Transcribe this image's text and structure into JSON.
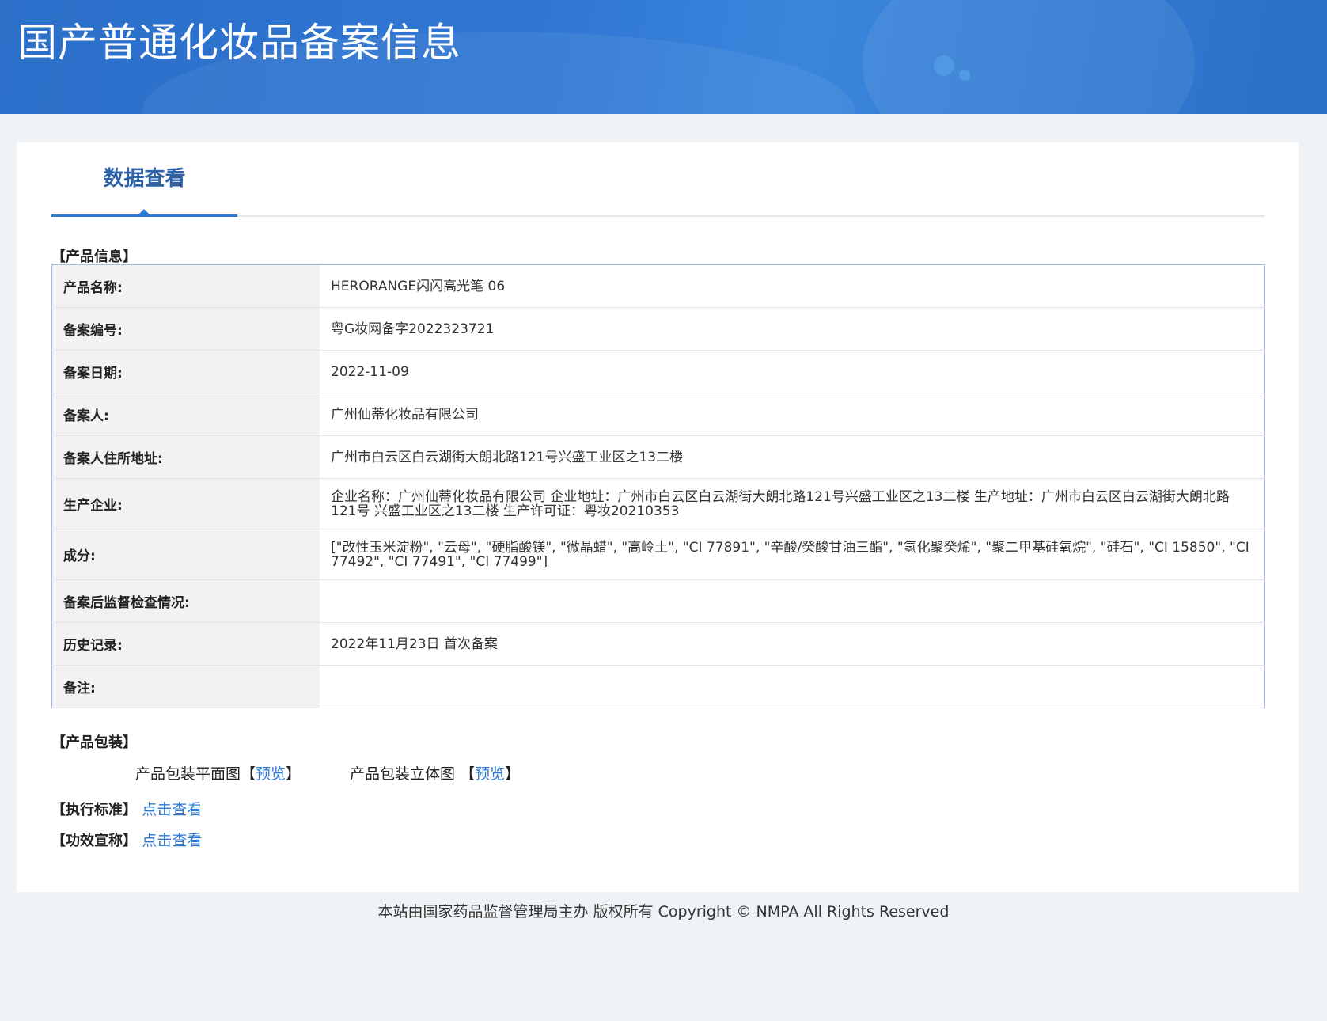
{
  "header": {
    "title": "国产普通化妆品备案信息"
  },
  "tab": {
    "label": "数据查看"
  },
  "sections": {
    "product_info": "【产品信息】",
    "packaging": "【产品包装】",
    "standard": "【执行标准】",
    "efficacy": "【功效宣称】"
  },
  "info_rows": [
    {
      "label": "产品名称:",
      "value": "HERORANGE闪闪高光笔 06"
    },
    {
      "label": "备案编号:",
      "value": "粤G妆网备字2022323721"
    },
    {
      "label": "备案日期:",
      "value": "2022-11-09"
    },
    {
      "label": "备案人:",
      "value": "广州仙蒂化妆品有限公司"
    },
    {
      "label": "备案人住所地址:",
      "value": "广州市白云区白云湖街大朗北路121号兴盛工业区之13二楼"
    },
    {
      "label": "生产企业:",
      "value": "企业名称：广州仙蒂化妆品有限公司 企业地址：广州市白云区白云湖街大朗北路121号兴盛工业区之13二楼 生产地址：广州市白云区白云湖街大朗北路121号 兴盛工业区之13二楼 生产许可证：粤妆20210353"
    },
    {
      "label": "成分:",
      "value": "[\"改性玉米淀粉\", \"云母\", \"硬脂酸镁\", \"微晶蜡\", \"高岭土\", \"CI 77891\", \"辛酸/癸酸甘油三酯\", \"氢化聚癸烯\", \"聚二甲基硅氧烷\", \"硅石\", \"CI 15850\", \"CI 77492\", \"CI 77491\", \"CI 77499\"]"
    },
    {
      "label": "备案后监督检查情况:",
      "value": ""
    },
    {
      "label": "历史记录:",
      "value": "2022年11月23日 首次备案"
    },
    {
      "label": "备注:",
      "value": ""
    }
  ],
  "packaging": {
    "flat_label": "产品包装平面图",
    "solid_label": "产品包装立体图",
    "bracket_open": "【",
    "bracket_close": "】",
    "preview": "预览"
  },
  "links": {
    "view": "点击查看"
  },
  "footer": {
    "text": "本站由国家药品监督管理局主办 版权所有 Copyright © NMPA All Rights Reserved"
  },
  "colors": {
    "banner": "#2f76d3",
    "accent": "#2e7ad1",
    "tab_text": "#2e62a8",
    "background": "#eff3f6"
  }
}
